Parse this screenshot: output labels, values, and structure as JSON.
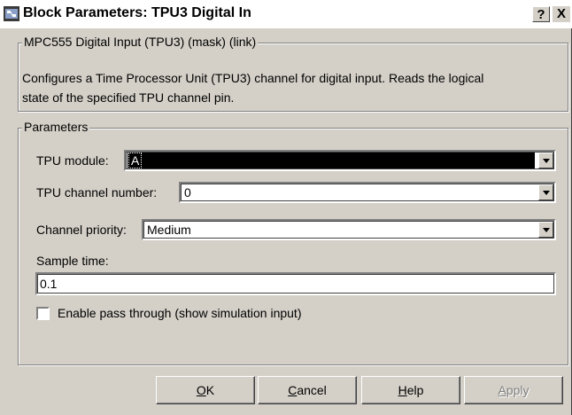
{
  "window": {
    "title": "Block Parameters: TPU3 Digital In",
    "help_label": "?",
    "close_label": "X"
  },
  "mask_group": {
    "legend": "MPC555 Digital Input (TPU3) (mask) (link)",
    "description_line1": "Configures a Time Processor Unit (TPU3) channel for digital input. Reads the logical",
    "description_line2": "state of the specified TPU channel pin."
  },
  "parameters": {
    "legend": "Parameters",
    "tpu_module": {
      "label": "TPU module:",
      "value": "A"
    },
    "tpu_channel": {
      "label": "TPU channel number:",
      "value": "0"
    },
    "priority": {
      "label": "Channel priority:",
      "value": "Medium"
    },
    "sample_time": {
      "label": "Sample time:",
      "value": "0.1"
    },
    "pass_through": {
      "label": "Enable pass through (show simulation input)",
      "checked": false
    }
  },
  "buttons": {
    "ok": {
      "mnemonic": "O",
      "rest": "K"
    },
    "cancel": {
      "mnemonic": "C",
      "rest": "ancel"
    },
    "help": {
      "mnemonic": "H",
      "rest": "elp"
    },
    "apply": {
      "mnemonic": "A",
      "rest": "pply"
    }
  }
}
